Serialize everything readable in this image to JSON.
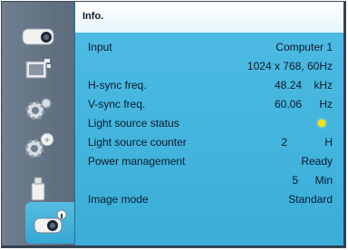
{
  "panel": {
    "title": "Info."
  },
  "sidebar": {
    "items": [
      {
        "icon": "image-adjust-icon"
      },
      {
        "icon": "display-icon"
      },
      {
        "icon": "settings-gear-icon"
      },
      {
        "icon": "expanded-settings-icon"
      },
      {
        "icon": "usb-icon"
      },
      {
        "icon": "info-icon",
        "active": true
      }
    ]
  },
  "info": {
    "input_label": "Input",
    "input_value": "Computer 1",
    "resolution": "1024 x 768, 60Hz",
    "hsync_label": "H-sync freq.",
    "hsync_value": "48.24",
    "hsync_unit": "kHz",
    "vsync_label": "V-sync freq.",
    "vsync_value": "60.06",
    "vsync_unit": "Hz",
    "light_status_label": "Light source status",
    "light_counter_label": "Light source counter",
    "light_counter_value": "2",
    "light_counter_unit": "H",
    "power_label": "Power management",
    "power_value": "Ready",
    "power_time_value": "5",
    "power_time_unit": "Min",
    "image_mode_label": "Image mode",
    "image_mode_value": "Standard"
  },
  "colors": {
    "panel": "#3aaed8",
    "header": "#ffffff",
    "sidebar": "#5b6b7b",
    "bulb": "#ffe000"
  }
}
